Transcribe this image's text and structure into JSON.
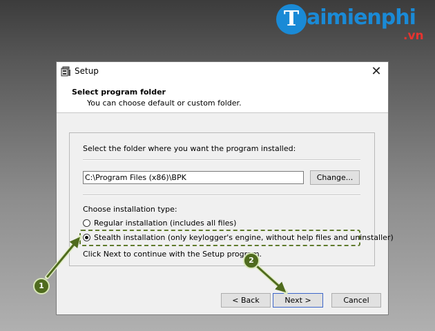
{
  "watermark": {
    "logo_letter": "T",
    "text": "aimienphi",
    "suffix": ".vn"
  },
  "window": {
    "title": "Setup",
    "close_glyph": "✕"
  },
  "header": {
    "title": "Select program folder",
    "subtitle": "You can choose default or custom folder."
  },
  "folder": {
    "prompt": "Select the folder where you want the program installed:",
    "path": "C:\\Program Files (x86)\\BPK",
    "change_label": "Change..."
  },
  "install_type": {
    "label": "Choose installation type:",
    "options": [
      {
        "label": "Regular installation (includes all files)",
        "selected": false
      },
      {
        "label": "Stealth installation (only keylogger's engine, without help files and uninstaller)",
        "selected": true
      }
    ],
    "continue_text": "Click Next to continue with the Setup program."
  },
  "buttons": {
    "back": "< Back",
    "next": "Next >",
    "cancel": "Cancel"
  },
  "annotations": {
    "marker1": "1",
    "marker2": "2"
  },
  "colors": {
    "annotation": "#4f6b1e",
    "link_accent": "#1a8ad6",
    "brand_red": "#e8332f"
  },
  "icons": [
    "setup-app-icon",
    "close-icon",
    "radio-icon"
  ]
}
